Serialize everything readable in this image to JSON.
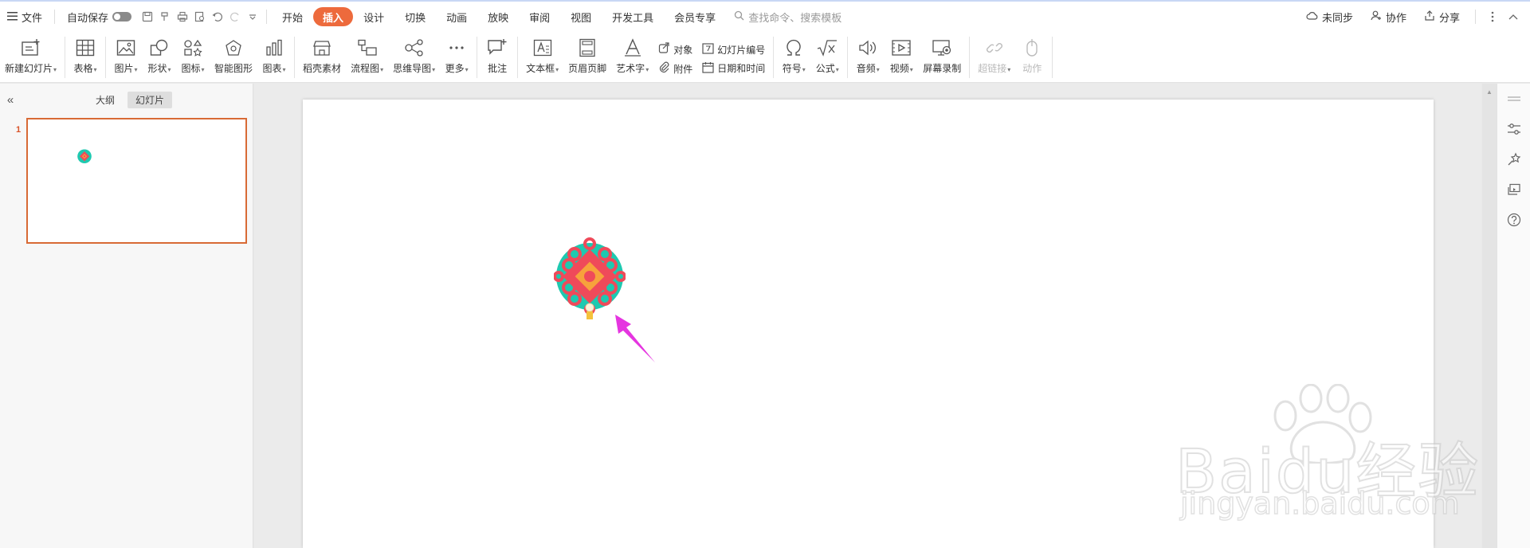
{
  "menubar": {
    "file_label": "文件",
    "autosave_label": "自动保存",
    "tabs": [
      "开始",
      "插入",
      "设计",
      "切换",
      "动画",
      "放映",
      "审阅",
      "视图",
      "开发工具",
      "会员专享"
    ],
    "active_tab": "插入",
    "search_placeholder": "查找命令、搜索模板",
    "right": {
      "sync_label": "未同步",
      "collab_label": "协作",
      "share_label": "分享"
    }
  },
  "ribbon": {
    "new_slide": "新建幻灯片",
    "table": "表格",
    "picture": "图片",
    "shape": "形状",
    "icon": "图标",
    "smart_graphic": "智能图形",
    "chart": "图表",
    "shell_material": "稻壳素材",
    "flowchart": "流程图",
    "mindmap": "思维导图",
    "more": "更多",
    "comment": "批注",
    "textbox": "文本框",
    "header_footer": "页眉页脚",
    "wordart": "艺术字",
    "object": "对象",
    "attachment": "附件",
    "slide_number": "幻灯片编号",
    "datetime": "日期和时间",
    "symbol": "符号",
    "formula": "公式",
    "audio": "音频",
    "video": "视频",
    "screen_record": "屏幕录制",
    "hyperlink": "超链接",
    "action": "动作"
  },
  "left_panel": {
    "outline_tab": "大纲",
    "slides_tab": "幻灯片",
    "slide_number": "1"
  },
  "watermark": {
    "main": "Baidu经验",
    "sub": "jingyan.baidu.com"
  },
  "colors": {
    "accent": "#ed6a3c",
    "knot_teal": "#1ec9b0",
    "knot_red": "#ef4a5a",
    "knot_orange": "#f7a23c",
    "arrow_magenta": "#e535e0"
  }
}
